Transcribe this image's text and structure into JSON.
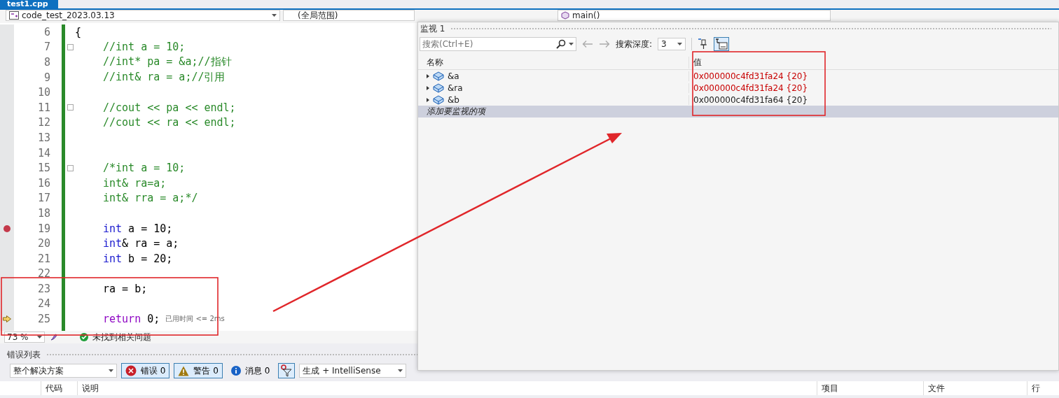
{
  "document_tab": {
    "title": "test1.cpp"
  },
  "navigation_bar": {
    "project": "code_test_2023.03.13",
    "scope": "(全局范围)",
    "function": "main()"
  },
  "editor": {
    "header_lines": [
      {
        "number": "6",
        "foldable": false,
        "breakpoint": false,
        "current": false,
        "segments": [
          {
            "kind": "plain",
            "text": "{"
          }
        ]
      }
    ],
    "body_lines": [
      {
        "number": "7",
        "foldable": true,
        "breakpoint": false,
        "current": false,
        "segments": [
          {
            "kind": "comment",
            "text": "//int a = 10;"
          }
        ]
      },
      {
        "number": "8",
        "foldable": false,
        "breakpoint": false,
        "current": false,
        "segments": [
          {
            "kind": "comment",
            "text": "//int* pa = &a;//指针"
          }
        ]
      },
      {
        "number": "9",
        "foldable": false,
        "breakpoint": false,
        "current": false,
        "segments": [
          {
            "kind": "comment",
            "text": "//int& ra = a;//引用"
          }
        ]
      },
      {
        "number": "10",
        "foldable": false,
        "breakpoint": false,
        "current": false
      },
      {
        "number": "11",
        "foldable": true,
        "breakpoint": false,
        "current": false,
        "segments": [
          {
            "kind": "comment",
            "text": "//cout << pa << endl;"
          }
        ]
      },
      {
        "number": "12",
        "foldable": false,
        "breakpoint": false,
        "current": false,
        "segments": [
          {
            "kind": "comment",
            "text": "//cout << ra << endl;"
          }
        ]
      },
      {
        "number": "13",
        "foldable": false,
        "breakpoint": false,
        "current": false
      },
      {
        "number": "14",
        "foldable": false,
        "breakpoint": false,
        "current": false
      },
      {
        "number": "15",
        "foldable": true,
        "breakpoint": false,
        "current": false,
        "segments": [
          {
            "kind": "comment",
            "text": "/*int a = 10;"
          }
        ]
      },
      {
        "number": "16",
        "foldable": false,
        "breakpoint": false,
        "current": false,
        "segments": [
          {
            "kind": "comment",
            "text": "int& ra=a;"
          }
        ]
      },
      {
        "number": "17",
        "foldable": false,
        "breakpoint": false,
        "current": false,
        "segments": [
          {
            "kind": "comment",
            "text": "int& rra = a;*/"
          }
        ]
      },
      {
        "number": "18",
        "foldable": false,
        "breakpoint": false,
        "current": false
      },
      {
        "number": "19",
        "foldable": false,
        "breakpoint": true,
        "current": false,
        "segments": [
          {
            "kind": "keyword",
            "text": "int"
          },
          {
            "kind": "plain",
            "text": " a = 10;"
          }
        ]
      },
      {
        "number": "20",
        "foldable": false,
        "breakpoint": false,
        "current": false,
        "segments": [
          {
            "kind": "keyword",
            "text": "int"
          },
          {
            "kind": "plain",
            "text": "& ra = a;"
          }
        ]
      },
      {
        "number": "21",
        "foldable": false,
        "breakpoint": false,
        "current": false,
        "segments": [
          {
            "kind": "keyword",
            "text": "int"
          },
          {
            "kind": "plain",
            "text": " b = 20;"
          }
        ]
      },
      {
        "number": "22",
        "foldable": false,
        "breakpoint": false,
        "current": false
      },
      {
        "number": "23",
        "foldable": false,
        "breakpoint": false,
        "current": false,
        "segments": [
          {
            "kind": "plain",
            "text": "ra = b;"
          }
        ]
      },
      {
        "number": "24",
        "foldable": false,
        "breakpoint": false,
        "current": false
      },
      {
        "number": "25",
        "foldable": false,
        "breakpoint": false,
        "current": true,
        "segments": [
          {
            "kind": "control",
            "text": "return"
          },
          {
            "kind": "plain",
            "text": " 0;"
          }
        ],
        "hint": "已用时间 <= 2ms"
      }
    ]
  },
  "editor_status": {
    "zoom": "73 %",
    "message": "未找到相关问题"
  },
  "watch_window": {
    "title": "监视 1",
    "search": {
      "placeholder": "搜索(Ctrl+E)"
    },
    "depth_label": "搜索深度:",
    "depth": "3",
    "columns": [
      "名称",
      "值"
    ],
    "rows": [
      {
        "name": "&a",
        "value": "0x000000c4fd31fa24 {20}",
        "changed": true
      },
      {
        "name": "&ra",
        "value": "0x000000c4fd31fa24 {20}",
        "changed": true
      },
      {
        "name": "&b",
        "value": "0x000000c4fd31fa64 {20}",
        "changed": false
      }
    ],
    "add_item": {
      "label": "添加要监视的项",
      "selected": true
    }
  },
  "error_list": {
    "title": "错误列表",
    "scope": "整个解决方案",
    "filters": [
      {
        "kind": "error",
        "label": "错误 0",
        "selected": true
      },
      {
        "kind": "warning",
        "label": "警告 0",
        "selected": true
      },
      {
        "kind": "info",
        "label": "消息 0",
        "selected": false
      }
    ],
    "source": "生成 + IntelliSense",
    "columns": [
      "代码",
      "说明",
      "项目",
      "文件",
      "行"
    ]
  }
}
